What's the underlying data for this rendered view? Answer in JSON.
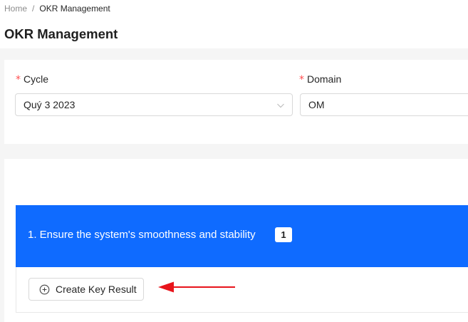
{
  "breadcrumb": {
    "home": "Home",
    "separator": "/",
    "current": "OKR Management"
  },
  "page": {
    "title": "OKR Management"
  },
  "filters": {
    "cycle": {
      "label": "Cycle",
      "required_mark": "*",
      "value": "Quý 3 2023"
    },
    "domain": {
      "label": "Domain",
      "required_mark": "*",
      "value": "OM"
    }
  },
  "objective": {
    "title": "1. Ensure the system's smoothness and stability",
    "badge_count": "1",
    "create_key_result_label": "Create Key Result"
  },
  "colors": {
    "objective_header": "#0f6bff",
    "required_mark": "#ff4d4f",
    "annotation_arrow": "#e8141b"
  },
  "icons": {
    "cycle_dropdown": "chevron-down-icon",
    "create_key_result": "plus-circle-icon",
    "annotation": "red-arrow-icon"
  }
}
